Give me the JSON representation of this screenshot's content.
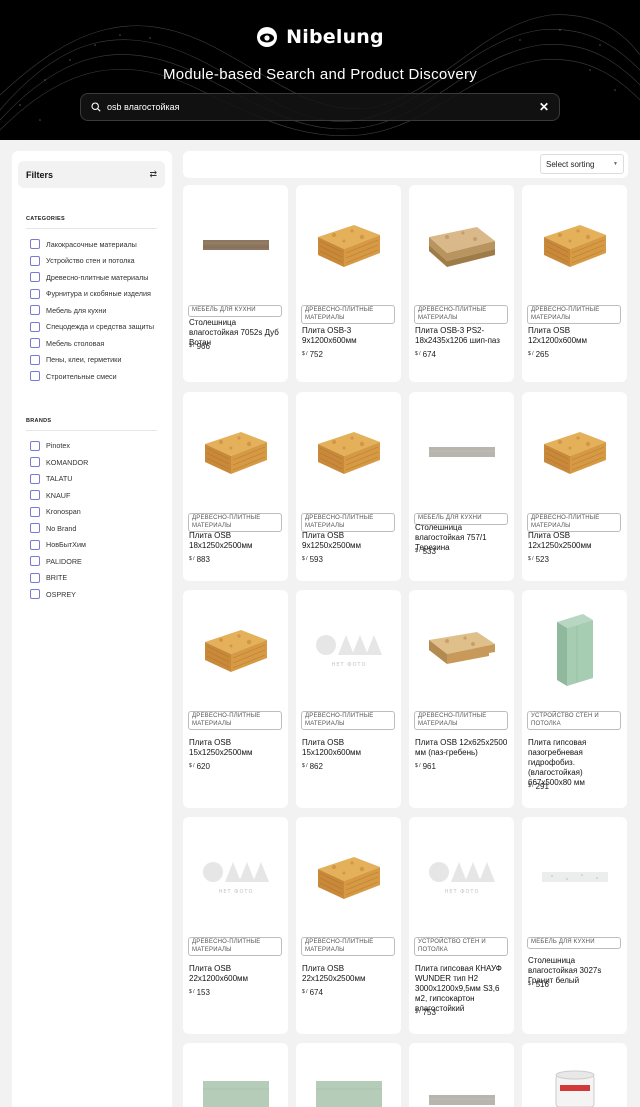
{
  "header": {
    "brand": "Nibelung",
    "title": "Module-based Search and Product Discovery",
    "search_value": "osb влагостойкая"
  },
  "sidebar": {
    "filters_label": "Filters",
    "categories_title": "CATEGORIES",
    "categories": [
      "Лакокрасочные материалы",
      "Устройство стен и потолка",
      "Древесно-плитные материалы",
      "Фурнитура и скобяные изделия",
      "Мебель для кухни",
      "Спецодежда и средства защиты",
      "Мебель столовая",
      "Пены, клеи, герметики",
      "Строительные смеси"
    ],
    "brands_title": "BRANDS",
    "brands": [
      "Pinotex",
      "KOMANDOR",
      "TALATU",
      "KNAUF",
      "Kronospan",
      "No Brand",
      "НовБытХим",
      "PALIDORE",
      "BRITE",
      "OSPREY"
    ]
  },
  "toolbar": {
    "sort_label": "Select sorting"
  },
  "currency": "$ /",
  "no_photo_label": "НЕТ ФОТО",
  "products": [
    {
      "image": "countertop-oak",
      "tag": "МЕБЕЛЬ ДЛЯ КУХНИ",
      "title": "Столешница влагостойкая 7052s Дуб Вотан",
      "price": "966"
    },
    {
      "image": "osb-block",
      "tag": "ДРЕВЕСНО-ПЛИТНЫЕ МАТЕРИАЛЫ",
      "title": "Плита OSB-3 9x1200x600мм",
      "price": "752"
    },
    {
      "image": "osb-sheets",
      "tag": "ДРЕВЕСНО-ПЛИТНЫЕ МАТЕРИАЛЫ",
      "title": "Плита OSB-3 PS2-18x2435x1206 шип-паз",
      "price": "674"
    },
    {
      "image": "osb-block",
      "tag": "ДРЕВЕСНО-ПЛИТНЫЕ МАТЕРИАЛЫ",
      "title": "Плита OSB 12x1200x600мм",
      "price": "265"
    },
    {
      "image": "osb-block",
      "tag": "ДРЕВЕСНО-ПЛИТНЫЕ МАТЕРИАЛЫ",
      "title": "Плита OSB 18x1250x2500мм",
      "price": "883"
    },
    {
      "image": "osb-block",
      "tag": "ДРЕВЕСНО-ПЛИТНЫЕ МАТЕРИАЛЫ",
      "title": "Плита OSB 9x1250x2500мм",
      "price": "593"
    },
    {
      "image": "countertop-grey",
      "tag": "МЕБЕЛЬ ДЛЯ КУХНИ",
      "title": "Столешница влагостойкая 757/1 Терезина",
      "price": "533"
    },
    {
      "image": "osb-block",
      "tag": "ДРЕВЕСНО-ПЛИТНЫЕ МАТЕРИАЛЫ",
      "title": "Плита OSB 12x1250x2500мм",
      "price": "523"
    },
    {
      "image": "osb-block",
      "tag": "ДРЕВЕСНО-ПЛИТНЫЕ МАТЕРИАЛЫ",
      "title": "Плита OSB 15x1250x2500мм",
      "price": "620"
    },
    {
      "image": "no-photo",
      "tag": "ДРЕВЕСНО-ПЛИТНЫЕ МАТЕРИАЛЫ",
      "title": "Плита OSB 15x1200x600мм",
      "price": "862"
    },
    {
      "image": "osb-tongue",
      "tag": "ДРЕВЕСНО-ПЛИТНЫЕ МАТЕРИАЛЫ",
      "title": "Плита OSB 12x625x2500 мм (паз-гребень)",
      "price": "961"
    },
    {
      "image": "gypsum-slab",
      "tag": "УСТРОЙСТВО СТЕН И ПОТОЛКА",
      "title": "Плита гипсовая пазогребневая гидрофобиз. (влагостойкая) 667x500x80 мм",
      "price": "291"
    },
    {
      "image": "no-photo",
      "tag": "ДРЕВЕСНО-ПЛИТНЫЕ МАТЕРИАЛЫ",
      "title": "Плита OSB 22x1200x600мм",
      "price": "153"
    },
    {
      "image": "osb-block",
      "tag": "ДРЕВЕСНО-ПЛИТНЫЕ МАТЕРИАЛЫ",
      "title": "Плита OSB 22x1250x2500мм",
      "price": "674"
    },
    {
      "image": "no-photo",
      "tag": "УСТРОЙСТВО СТЕН И ПОТОЛКА",
      "title": "Плита гипсовая КНАУФ WUNDER тип Н2 3000x1200x9,5мм S3,6 м2, гипсокартон влагостойкий",
      "price": "753"
    },
    {
      "image": "countertop-white",
      "tag": "МЕБЕЛЬ ДЛЯ КУХНИ",
      "title": "Столешница влагостойкая 3027s Гранит белый",
      "price": "516"
    },
    {
      "image": "gypsum-board",
      "tag": "",
      "title": "",
      "price": ""
    },
    {
      "image": "gypsum-board",
      "tag": "",
      "title": "",
      "price": ""
    },
    {
      "image": "countertop-grey",
      "tag": "",
      "title": "",
      "price": ""
    },
    {
      "image": "paint-bucket",
      "tag": "",
      "title": "",
      "price": ""
    }
  ],
  "colors": {
    "accent": "#7a7ad0",
    "header_bg": "#000000",
    "page_bg": "#f2f2f2"
  }
}
